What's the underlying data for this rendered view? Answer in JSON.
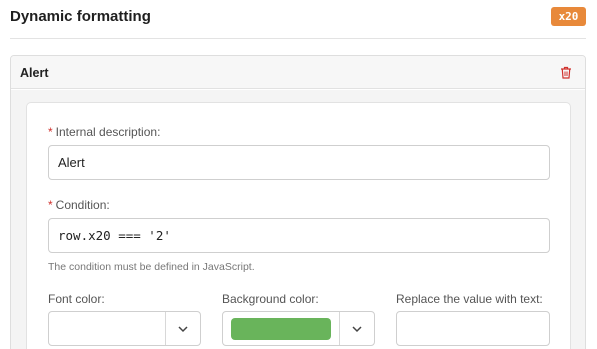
{
  "header": {
    "title": "Dynamic formatting",
    "field_badge": "x20"
  },
  "rule": {
    "title": "Alert",
    "delete_icon": "trash-icon",
    "fields": {
      "description": {
        "label": "Internal description:",
        "required_mark": "*",
        "value": "Alert"
      },
      "condition": {
        "label": "Condition:",
        "required_mark": "*",
        "value": "row.x20 === '2'",
        "hint": "The condition must be defined in JavaScript."
      },
      "font_color": {
        "label": "Font color:",
        "value": "",
        "icon": "chevron-down-icon"
      },
      "background_color": {
        "label": "Background color:",
        "swatch_color": "#69b45b",
        "icon": "chevron-down-icon"
      },
      "replace_text": {
        "label": "Replace the value with text:",
        "value": ""
      }
    }
  },
  "colors": {
    "badge": "#e8893a",
    "required": "#d0312d",
    "delete": "#d0312d"
  }
}
